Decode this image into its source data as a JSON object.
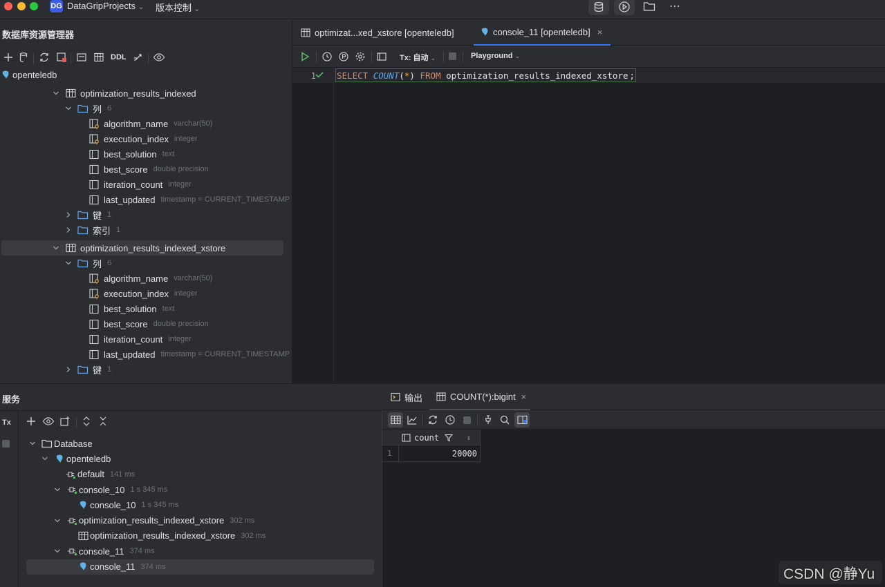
{
  "titlebar": {
    "badge": "DG",
    "project": "DataGripProjects",
    "vcs": "版本控制",
    "icons": [
      "database-icon",
      "run-icon",
      "folder-icon",
      "more-icon"
    ],
    "traffic_colors": [
      "#ff5f57",
      "#febc2e",
      "#28c840"
    ]
  },
  "db_explorer": {
    "title": "数据库资源管理器",
    "toolbar": {
      "ddl": "DDL"
    },
    "root": "openteledb",
    "tables": [
      {
        "name": "optimization_results_indexed",
        "columns_label": "列",
        "columns_count": "6",
        "columns": [
          {
            "name": "algorithm_name",
            "type": "varchar(50)",
            "icon": "key-column-icon"
          },
          {
            "name": "execution_index",
            "type": "integer",
            "icon": "key-column-icon"
          },
          {
            "name": "best_solution",
            "type": "text",
            "icon": "column-icon"
          },
          {
            "name": "best_score",
            "type": "double precision",
            "icon": "column-icon"
          },
          {
            "name": "iteration_count",
            "type": "integer",
            "icon": "column-icon"
          },
          {
            "name": "last_updated",
            "type": "timestamp = CURRENT_TIMESTAMP",
            "icon": "column-icon"
          }
        ],
        "keys_label": "键",
        "keys_count": "1",
        "index_label": "索引",
        "index_count": "1"
      },
      {
        "name": "optimization_results_indexed_xstore",
        "columns_label": "列",
        "columns_count": "6",
        "columns": [
          {
            "name": "algorithm_name",
            "type": "varchar(50)",
            "icon": "key-column-icon"
          },
          {
            "name": "execution_index",
            "type": "integer",
            "icon": "key-column-icon"
          },
          {
            "name": "best_solution",
            "type": "text",
            "icon": "column-icon"
          },
          {
            "name": "best_score",
            "type": "double precision",
            "icon": "column-icon"
          },
          {
            "name": "iteration_count",
            "type": "integer",
            "icon": "column-icon"
          },
          {
            "name": "last_updated",
            "type": "timestamp = CURRENT_TIMESTAMP",
            "icon": "column-icon"
          }
        ],
        "keys_label": "键",
        "keys_count": "1"
      }
    ]
  },
  "editor": {
    "tabs": [
      {
        "label": "optimizat...xed_xstore [openteledb]",
        "active": false
      },
      {
        "label": "console_11 [openteledb]",
        "active": true
      }
    ],
    "toolbar": {
      "tx": "Tx: 自动",
      "playground": "Playground"
    },
    "lines": [
      {
        "number": "1",
        "kw1": "SELECT",
        "fn": "COUNT",
        "lparen": "(",
        "star": "*",
        "rparen": ")",
        "kw2": "FROM",
        "ident": "optimization_results_indexed_xstore",
        "semi": ";"
      }
    ]
  },
  "services": {
    "title": "服务",
    "tx": "Tx",
    "tree": [
      {
        "label": "Database",
        "meta": "",
        "level": 0,
        "icon": "folder-icon",
        "chevron": true
      },
      {
        "label": "openteledb",
        "meta": "",
        "level": 1,
        "icon": "postgres-icon",
        "chevron": true
      },
      {
        "label": "default",
        "meta": "141 ms",
        "level": 2,
        "icon": "session-icon",
        "chevron": false
      },
      {
        "label": "console_10",
        "meta": "1 s 345 ms",
        "level": 2,
        "icon": "session-icon",
        "chevron": true
      },
      {
        "label": "console_10",
        "meta": "1 s 345 ms",
        "level": 3,
        "icon": "postgres-icon",
        "chevron": false
      },
      {
        "label": "optimization_results_indexed_xstore",
        "meta": "302 ms",
        "level": 2,
        "icon": "session-icon",
        "chevron": true
      },
      {
        "label": "optimization_results_indexed_xstore",
        "meta": "302 ms",
        "level": 3,
        "icon": "table-icon",
        "chevron": false
      },
      {
        "label": "console_11",
        "meta": "374 ms",
        "level": 2,
        "icon": "session-icon",
        "chevron": true
      },
      {
        "label": "console_11",
        "meta": "374 ms",
        "level": 3,
        "icon": "postgres-icon",
        "chevron": false,
        "selected": true
      }
    ],
    "results": {
      "tabs": [
        {
          "label": "输出"
        },
        {
          "label": "COUNT(*):bigint"
        }
      ],
      "columns": [
        "count"
      ],
      "rows": [
        {
          "num": "1",
          "cells": [
            "20000"
          ]
        }
      ]
    }
  },
  "watermark": "CSDN @静Yu"
}
